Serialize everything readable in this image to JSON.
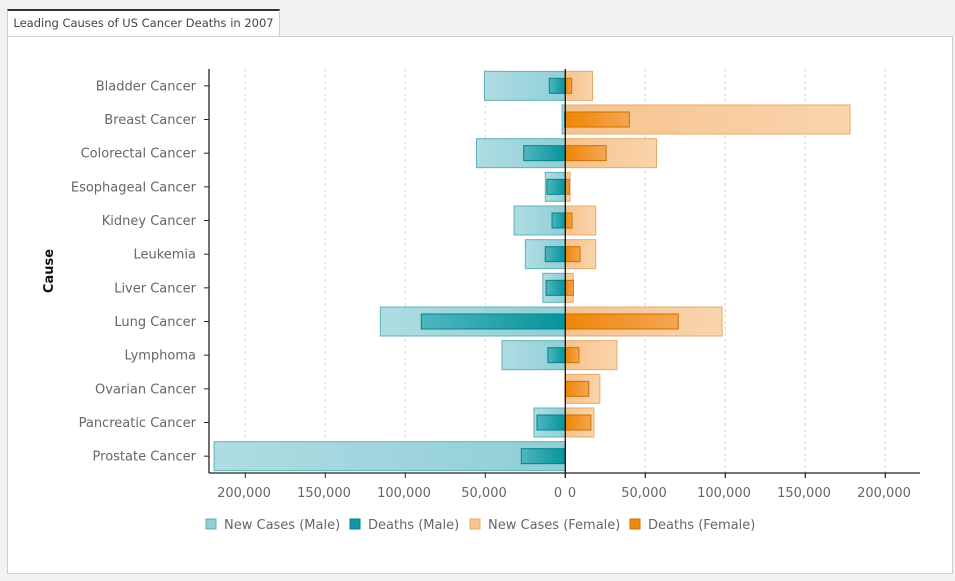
{
  "tab": {
    "label": "Leading Causes of US Cancer Deaths in 2007"
  },
  "colors": {
    "new_male": "#8fd0d6",
    "death_male": "#0f9aa3",
    "new_female": "#f7c48d",
    "death_female": "#f08a0f"
  },
  "chart_data": {
    "type": "bar",
    "orientation": "horizontal",
    "layout": "diverging (male left, female right; overlaid new cases and deaths)",
    "title": "Leading Causes of US Cancer Deaths in 2007",
    "xlabel": "",
    "ylabel": "Cause",
    "categories": [
      "Bladder Cancer",
      "Breast Cancer",
      "Colorectal Cancer",
      "Esophageal Cancer",
      "Kidney Cancer",
      "Leukemia",
      "Liver Cancer",
      "Lung Cancer",
      "Lymphoma",
      "Ovarian Cancer",
      "Pancreatic Cancer",
      "Prostate Cancer"
    ],
    "series": [
      {
        "name": "New Cases (Male)",
        "side": "left",
        "values": [
          50500,
          2000,
          55500,
          12500,
          32000,
          25000,
          14000,
          115600,
          39600,
          0,
          19600,
          219500
        ]
      },
      {
        "name": "Deaths (Male)",
        "side": "left",
        "values": [
          10000,
          450,
          26000,
          11500,
          8300,
          12500,
          12000,
          90000,
          10900,
          0,
          17700,
          27500
        ]
      },
      {
        "name": "New Cases (Female)",
        "side": "right",
        "values": [
          17000,
          178000,
          57000,
          3000,
          19000,
          19000,
          5000,
          98000,
          32300,
          21600,
          17900,
          0
        ]
      },
      {
        "name": "Deaths (Female)",
        "side": "right",
        "values": [
          4000,
          40000,
          25500,
          2500,
          4200,
          9200,
          5000,
          70600,
          8500,
          14700,
          16000,
          0
        ]
      }
    ],
    "xlim": [
      -222000,
      222000
    ],
    "xticks": [
      -200000,
      -150000,
      -100000,
      -50000,
      0,
      50000,
      100000,
      150000,
      200000
    ],
    "xtick_labels": [
      "200,000",
      "150,000",
      "100,000",
      "50,000",
      "0",
      "0",
      "50,000",
      "100,000",
      "150,000",
      "200,000"
    ],
    "grid": "vertical dashed",
    "legend": {
      "position": "bottom",
      "items": [
        "New Cases (Male)",
        "Deaths (Male)",
        "New Cases (Female)",
        "Deaths (Female)"
      ]
    }
  }
}
